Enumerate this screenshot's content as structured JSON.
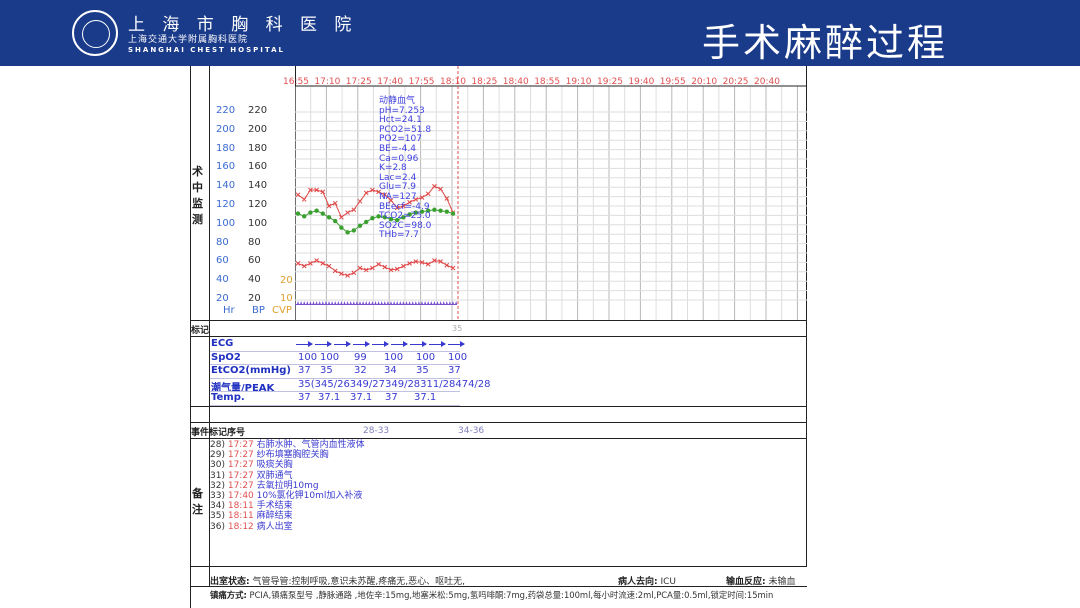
{
  "header": {
    "hospital_cn": "上 海 市 胸 科 医 院",
    "hospital_cn_sub": "上海交通大学附属胸科医院",
    "hospital_en": "SHANGHAI CHEST HOSPITAL",
    "title": "手术麻醉过程"
  },
  "sections": {
    "monitoring": "术中监测",
    "marker": "标记",
    "event_seq": "事件标记序号",
    "notes": "备注"
  },
  "time_axis": [
    "16:55",
    "17:10",
    "17:25",
    "17:40",
    "17:55",
    "18:10",
    "18:25",
    "18:40",
    "18:55",
    "19:10",
    "19:25",
    "19:40",
    "19:55",
    "20:10",
    "20:25",
    "20:40"
  ],
  "axes": {
    "hr_ticks": [
      "220",
      "200",
      "180",
      "160",
      "140",
      "120",
      "100",
      "80",
      "60",
      "40",
      "20"
    ],
    "bp_ticks": [
      "220",
      "200",
      "180",
      "160",
      "140",
      "120",
      "100",
      "80",
      "60",
      "40",
      "20"
    ],
    "cvp_ticks": [
      "20",
      "10"
    ],
    "hr_label": "Hr",
    "bp_label": "BP",
    "cvp_label": "CVP"
  },
  "blood_gas": [
    "动静血气",
    "pH=7.253",
    "Hct=24.1",
    "PCO2=51.8",
    "PO2=107",
    "BE=-4.4",
    "Ca=0.96",
    "K=2.8",
    "Lac=2.4",
    "Glu=7.9",
    "NA=127",
    "BEecf=-4.9",
    "TCO2=25.0",
    "SO2C=98.0",
    "THb=7.7"
  ],
  "chart_data": {
    "type": "line",
    "x": [
      0,
      1,
      2,
      3,
      4,
      5,
      6,
      7,
      8,
      9,
      10,
      11,
      12,
      13,
      14,
      15,
      16,
      17,
      18,
      19,
      20,
      21,
      22,
      23,
      24,
      25
    ],
    "series": [
      {
        "values": [
          132,
          127,
          137,
          137,
          135,
          120,
          123,
          108,
          113,
          116,
          125,
          134,
          137,
          135,
          132,
          126,
          118,
          120,
          124,
          127,
          129,
          133,
          141,
          138,
          128,
          113
        ]
      },
      {
        "values": [
          112,
          109,
          113,
          115,
          112,
          108,
          104,
          97,
          92,
          94,
          99,
          103,
          107,
          109,
          108,
          106,
          105,
          108,
          111,
          113,
          114,
          115,
          116,
          115,
          114,
          112
        ]
      },
      {
        "values": [
          59,
          56,
          59,
          62,
          59,
          56,
          51,
          48,
          46,
          49,
          54,
          52,
          54,
          58,
          55,
          52,
          53,
          56,
          59,
          61,
          60,
          58,
          62,
          61,
          57,
          54
        ]
      }
    ]
  },
  "vitals_rows": [
    {
      "label": "ECG",
      "values": []
    },
    {
      "label": "SpO2",
      "values": [
        "100",
        "100",
        "99",
        "100",
        "100",
        "100"
      ]
    },
    {
      "label": "EtCO2(mmHg)",
      "values": [
        "37",
        "35",
        "32",
        "34",
        "35",
        "37"
      ]
    },
    {
      "label": "潮气量/PEAK",
      "values": [
        "35(345/26349/27349/28311/28474/28"
      ]
    },
    {
      "label": "Temp.",
      "values": [
        "37",
        "37.1",
        "37.1",
        "37",
        "37.1"
      ]
    }
  ],
  "marker_value": "35",
  "event_seq": [
    "28-33",
    "34-36"
  ],
  "notes": [
    {
      "no": "28)",
      "time": "17:27",
      "text": "右肺水肿、气管内血性液体"
    },
    {
      "no": "29)",
      "time": "17:27",
      "text": "纱布填塞胸腔关胸"
    },
    {
      "no": "30)",
      "time": "17:27",
      "text": "吸痰关胸"
    },
    {
      "no": "31)",
      "time": "17:27",
      "text": "双肺通气"
    },
    {
      "no": "32)",
      "time": "17:27",
      "text": "去氧拉明10mg"
    },
    {
      "no": "33)",
      "time": "17:40",
      "text": "10%氯化钾10ml加入补液"
    },
    {
      "no": "34)",
      "time": "18:11",
      "text": "手术结束"
    },
    {
      "no": "35)",
      "time": "18:11",
      "text": "麻醉结束"
    },
    {
      "no": "36)",
      "time": "18:12",
      "text": "病人出室"
    }
  ],
  "footer": {
    "exit_label": "出室状态:",
    "exit_text": "气管导管:控制呼吸,意识未苏醒,疼痛无,恶心、呕吐无,",
    "dest_label": "病人去向:",
    "dest_value": "ICU",
    "transfusion_label": "输血反应:",
    "transfusion_value": "未输血",
    "analgesia_label": "镇痛方式:",
    "analgesia_text": "PCIA,镇痛泵型号 ,静脉通路 ,地佐辛:15mg,地塞米松:5mg,氢吗啡酮:7mg,药袋总量:100ml,每小时流速:2ml,PCA量:0.5ml,锁定时间:15min"
  }
}
